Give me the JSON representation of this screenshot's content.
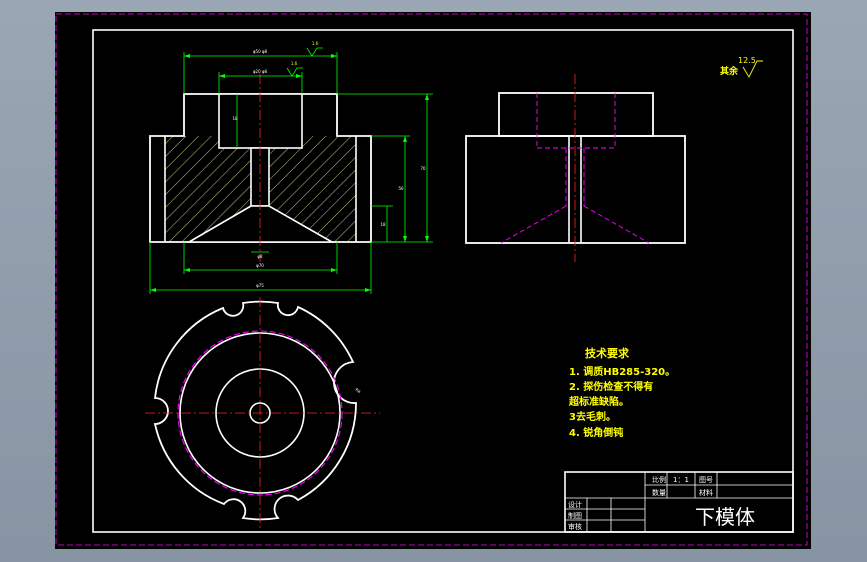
{
  "colors": {
    "background": "#000000",
    "outline": "#ffffff",
    "dimension": "#00ff00",
    "centerline": "#ff2020",
    "hidden": "#ff00ff",
    "annotation": "#ffff00",
    "hatch": "#c8c878"
  },
  "surface_finish": {
    "default_value": "12.5",
    "default_label": "其余",
    "top_value": "1.6",
    "bore_value": "1.6"
  },
  "dimensions": {
    "top_width": "φ50 φ8",
    "bore_width": "φ20 φ8",
    "bore_depth": "18",
    "side_h1": "70",
    "side_h2": "56",
    "side_h3": "18",
    "hole_dia": "φ8",
    "base_width": "φ70",
    "overall_width": "φ75",
    "slot_size": "R4"
  },
  "tech_requirements": {
    "title": "技术要求",
    "items": [
      "1. 调质HB285-320。",
      "2. 探伤检查不得有",
      "超标准缺陷。",
      "3去毛刺。",
      "4. 锐角倒钝"
    ]
  },
  "title_block": {
    "scale_label": "比例",
    "scale_value": "1：1",
    "drawing_no_label": "图号",
    "quantity_label": "数量",
    "material_label": "材料",
    "designer_label": "设计",
    "drafter_label": "制图",
    "reviewer_label": "审核",
    "part_name": "下模体"
  }
}
